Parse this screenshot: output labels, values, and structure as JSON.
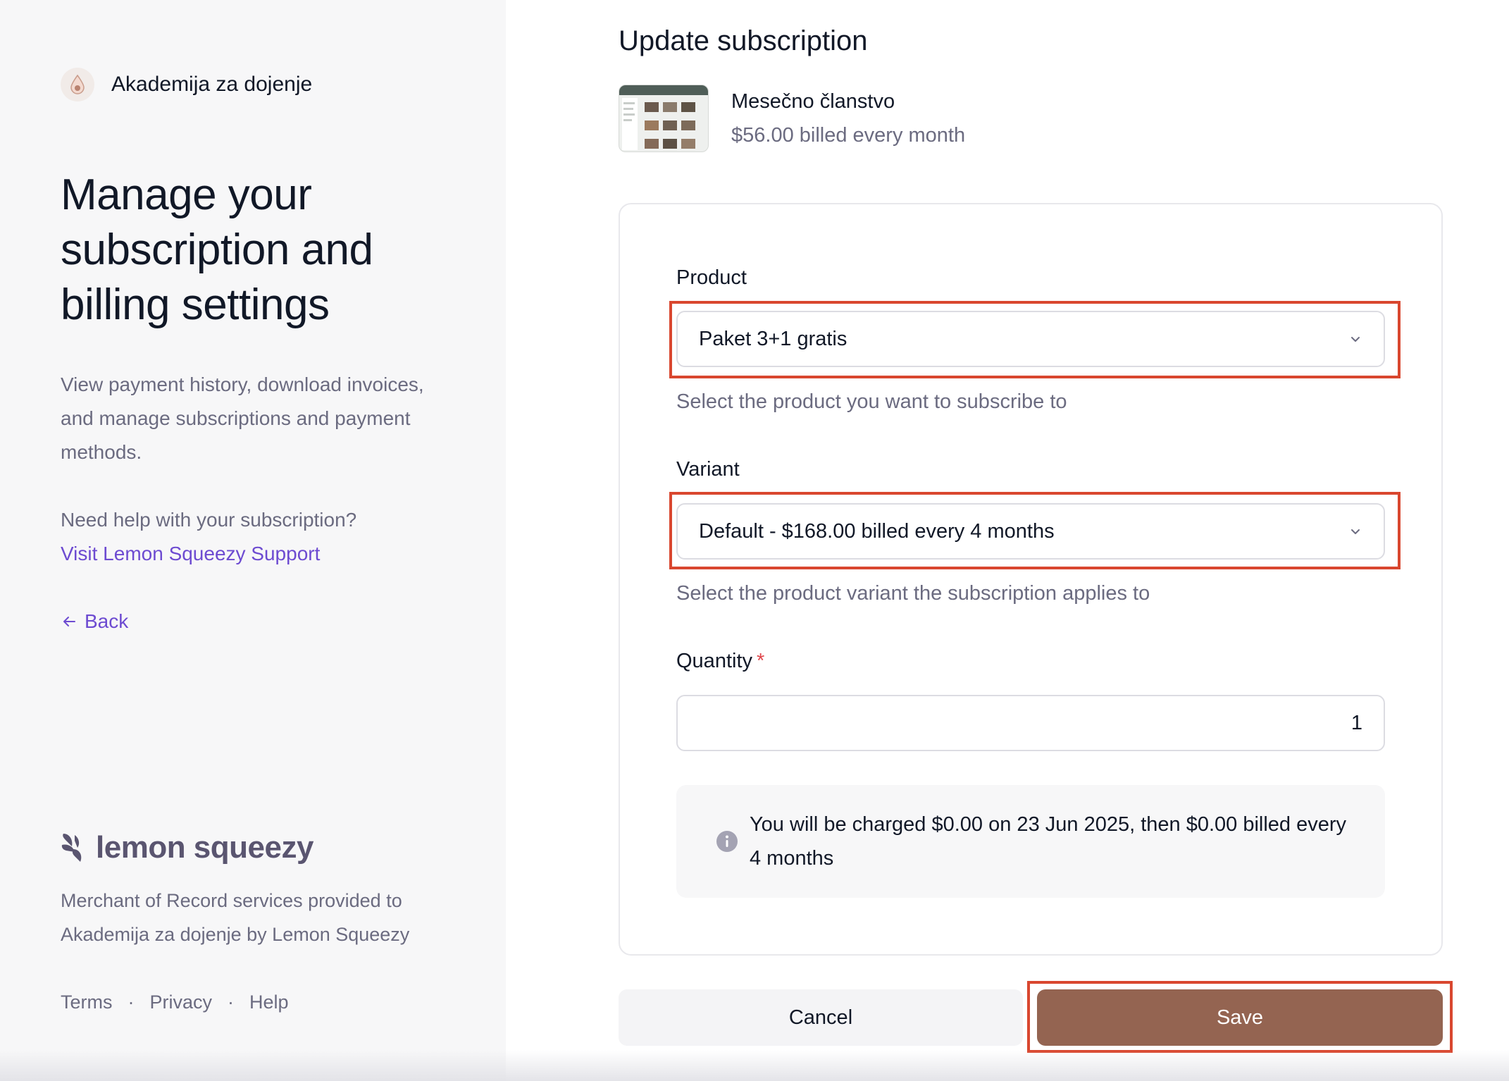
{
  "sidebar": {
    "store_name": "Akademija za dojenje",
    "title": "Manage your subscription and billing settings",
    "description": "View payment history, download invoices, and manage subscriptions and payment methods.",
    "help_question": "Need help with your subscription?",
    "help_link": "Visit Lemon Squeezy Support",
    "back_label": "Back",
    "brand_wordmark": "lemon squeezy",
    "merchant_text": "Merchant of Record services provided to Akademija za dojenje by Lemon Squeezy",
    "footer": {
      "terms": "Terms",
      "privacy": "Privacy",
      "help": "Help",
      "separator": "·"
    }
  },
  "main": {
    "title": "Update subscription",
    "current_product": {
      "name": "Mesečno članstvo",
      "price": "$56.00 billed every month"
    },
    "form": {
      "product": {
        "label": "Product",
        "value": "Paket 3+1 gratis",
        "hint": "Select the product you want to subscribe to"
      },
      "variant": {
        "label": "Variant",
        "value": "Default - $168.00 billed every 4 months",
        "hint": "Select the product variant the subscription applies to"
      },
      "quantity": {
        "label": "Quantity",
        "required_mark": "*",
        "value": "1"
      },
      "notice": "You will be charged $0.00 on 23 Jun 2025, then $0.00 billed every 4 months"
    },
    "actions": {
      "cancel": "Cancel",
      "save": "Save"
    }
  },
  "colors": {
    "accent_link": "#6d4bd1",
    "save_button": "#946451",
    "highlight": "#d9472f"
  },
  "icons": {
    "store_logo": "droplet-icon",
    "back": "arrow-left-icon",
    "select": "chevron-down-icon",
    "notice": "info-icon"
  }
}
